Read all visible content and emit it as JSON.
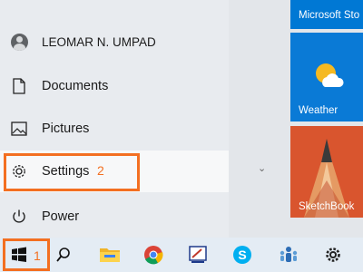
{
  "start_menu": {
    "user": {
      "name": "LEOMAR N. UMPAD",
      "icon": "user-avatar-icon"
    },
    "items": [
      {
        "label": "Documents",
        "icon": "document-icon"
      },
      {
        "label": "Pictures",
        "icon": "picture-icon"
      },
      {
        "label": "Settings",
        "icon": "gear-icon"
      },
      {
        "label": "Power",
        "icon": "power-icon"
      }
    ],
    "expand_icon": "chevron-down-icon"
  },
  "tiles": [
    {
      "label": "Microsoft Sto",
      "color": "#0078d4"
    },
    {
      "label": "Weather",
      "color": "#0a7ad6"
    },
    {
      "label": "SketchBook",
      "color": "#d9552e"
    }
  ],
  "annotations": {
    "settings_step": "2",
    "start_step": "1",
    "highlight_color": "#f36f21"
  },
  "taskbar": {
    "icons": [
      "windows-start-icon",
      "search-icon",
      "file-explorer-icon",
      "chrome-icon",
      "snipping-tool-icon",
      "skype-icon",
      "people-icon",
      "settings-gear-icon"
    ]
  }
}
